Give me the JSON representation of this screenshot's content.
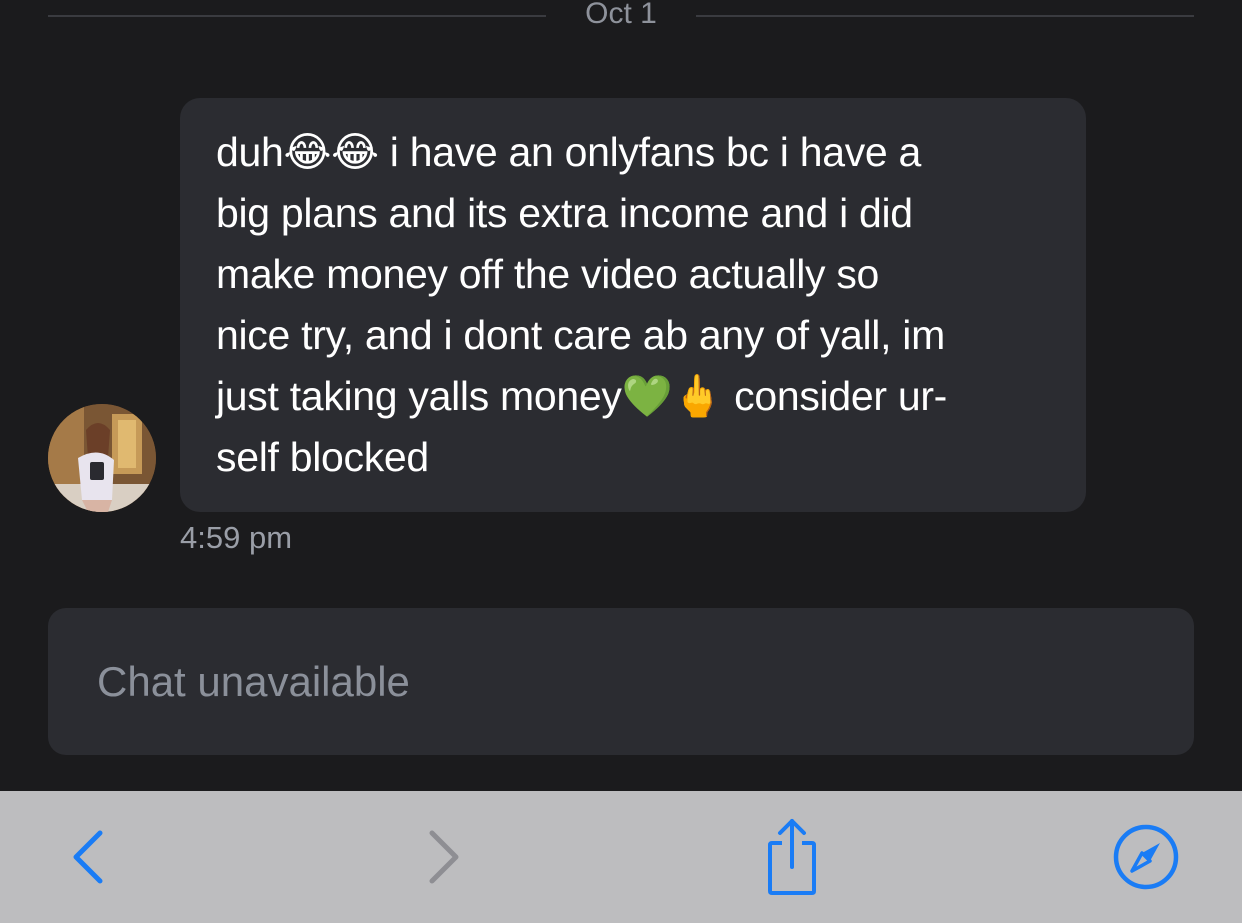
{
  "date_divider": {
    "label": "Oct 1"
  },
  "message": {
    "text": "duh😂😂 i have an onlyfans bc i have a\nbig plans and its extra income and i did\nmake money off the video actually so\nnice try, and i dont care ab any of yall, im\njust taking yalls money💚🖕 consider ur-\nself blocked",
    "timestamp": "4:59 pm"
  },
  "composer": {
    "status": "Chat unavailable"
  },
  "toolbar": {
    "back_icon": "chevron-left-icon",
    "forward_icon": "chevron-right-icon",
    "share_icon": "share-icon",
    "compass_icon": "compass-icon",
    "accent_color": "#1a7cf5",
    "disabled_color": "#8e8e93"
  }
}
